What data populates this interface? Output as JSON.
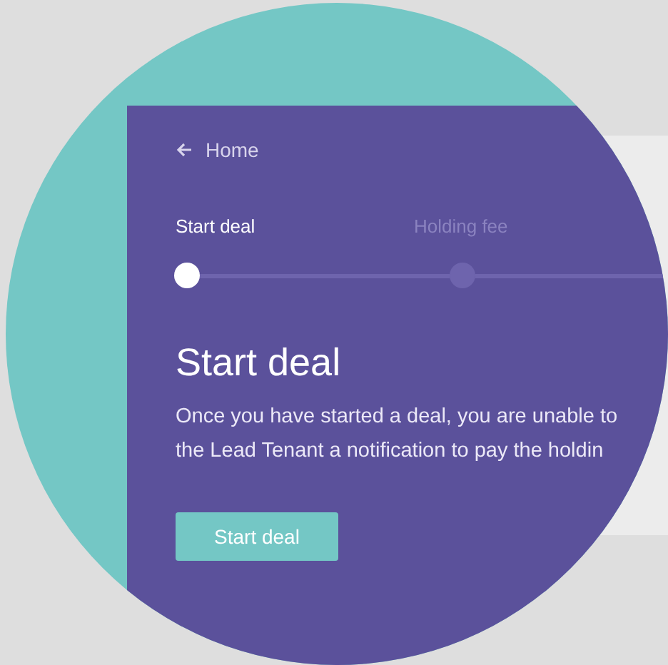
{
  "nav": {
    "back_label": "Home"
  },
  "steps": [
    {
      "label": "Start deal",
      "selected": true
    },
    {
      "label": "Holding fee",
      "selected": false
    }
  ],
  "heading": "Start deal",
  "description": [
    "Once you have started a deal, you are unable to",
    "the Lead Tenant a notification to pay the holdin"
  ],
  "primary_button": "Start deal"
}
